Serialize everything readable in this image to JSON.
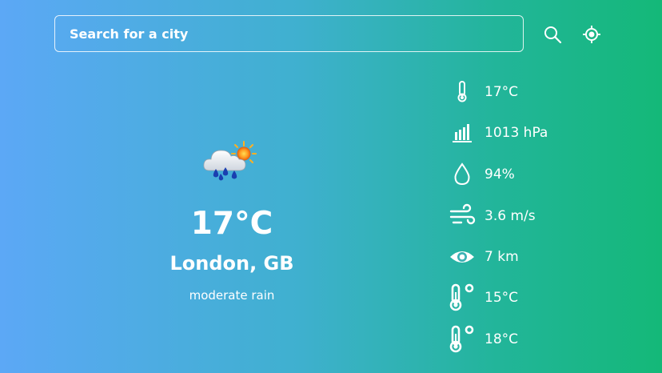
{
  "search": {
    "placeholder": "Search for a city",
    "value": ""
  },
  "actions": [
    {
      "name": "search-button",
      "icon": "search-icon"
    },
    {
      "name": "locate-button",
      "icon": "crosshair-location-icon"
    }
  ],
  "current": {
    "icon": "rain-cloud-sun-icon",
    "temperature": "17°C",
    "location": "London, GB",
    "description": "moderate rain"
  },
  "stats": [
    {
      "key": "temperature",
      "icon": "thermometer-icon",
      "value": "17°C"
    },
    {
      "key": "pressure",
      "icon": "pressure-bars-icon",
      "value": "1013 hPa"
    },
    {
      "key": "humidity",
      "icon": "water-drop-icon",
      "value": "94%"
    },
    {
      "key": "wind",
      "icon": "wind-icon",
      "value": "3.6 m/s"
    },
    {
      "key": "visibility",
      "icon": "eye-icon",
      "value": "7 km"
    },
    {
      "key": "temp-min",
      "icon": "thermometer-degree-icon",
      "value": "15°C"
    },
    {
      "key": "temp-max",
      "icon": "thermometer-degree-icon",
      "value": "18°C"
    }
  ],
  "colors": {
    "gradient_start": "#5ca8f6",
    "gradient_end": "#14b878",
    "text": "#ffffff"
  }
}
